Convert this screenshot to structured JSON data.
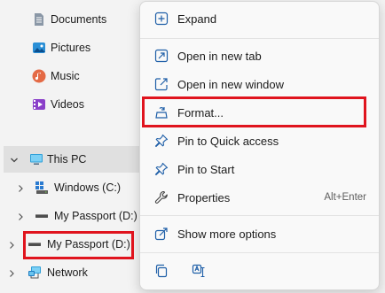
{
  "nav": {
    "items": [
      {
        "label": "Documents",
        "icon": "documents-icon"
      },
      {
        "label": "Pictures",
        "icon": "pictures-icon"
      },
      {
        "label": "Music",
        "icon": "music-icon"
      },
      {
        "label": "Videos",
        "icon": "videos-icon"
      },
      {
        "label": "This PC",
        "icon": "pc-icon"
      },
      {
        "label": "Windows (C:)",
        "icon": "windows-drive-icon"
      },
      {
        "label": "My Passport (D:)",
        "icon": "drive-icon"
      },
      {
        "label": "My Passport (D:)",
        "icon": "drive-icon"
      },
      {
        "label": "Network",
        "icon": "network-icon"
      }
    ]
  },
  "menu": {
    "items": [
      {
        "label": "Expand",
        "icon": "expand-icon"
      },
      {
        "label": "Open in new tab",
        "icon": "new-tab-icon"
      },
      {
        "label": "Open in new window",
        "icon": "new-window-icon"
      },
      {
        "label": "Format...",
        "icon": "format-icon"
      },
      {
        "label": "Pin to Quick access",
        "icon": "pin-icon"
      },
      {
        "label": "Pin to Start",
        "icon": "pin-icon"
      },
      {
        "label": "Properties",
        "icon": "wrench-icon",
        "shortcut": "Alt+Enter"
      },
      {
        "label": "Show more options",
        "icon": "share-icon"
      }
    ],
    "bottom_icons": [
      "copy-icon",
      "rename-icon"
    ]
  },
  "colors": {
    "highlight": "#e0141e",
    "accent": "#0067c0"
  }
}
